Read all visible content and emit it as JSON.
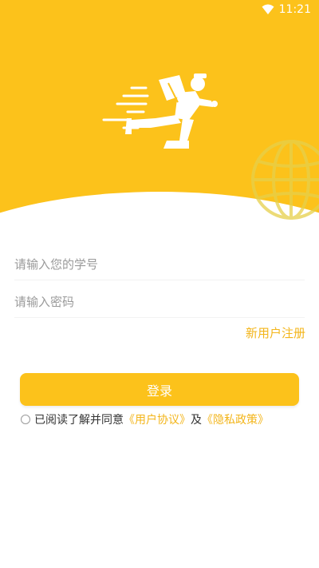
{
  "status_bar": {
    "time": "11:21",
    "wifi_icon": "wifi-icon"
  },
  "brand": {
    "accent": "#fcc21b",
    "link": "#f3b51a",
    "runner_icon": "delivery-runner-icon",
    "globe_icon": "globe-icon"
  },
  "form": {
    "student_id_placeholder": "请输入您的学号",
    "password_placeholder": "请输入密码",
    "register_label": "新用户注册",
    "login_label": "登录"
  },
  "agreement": {
    "prefix": "已阅读了解并同意",
    "user_agreement": "《用户协议》",
    "and": "及",
    "privacy_policy": "《隐私政策》",
    "checked": false
  }
}
